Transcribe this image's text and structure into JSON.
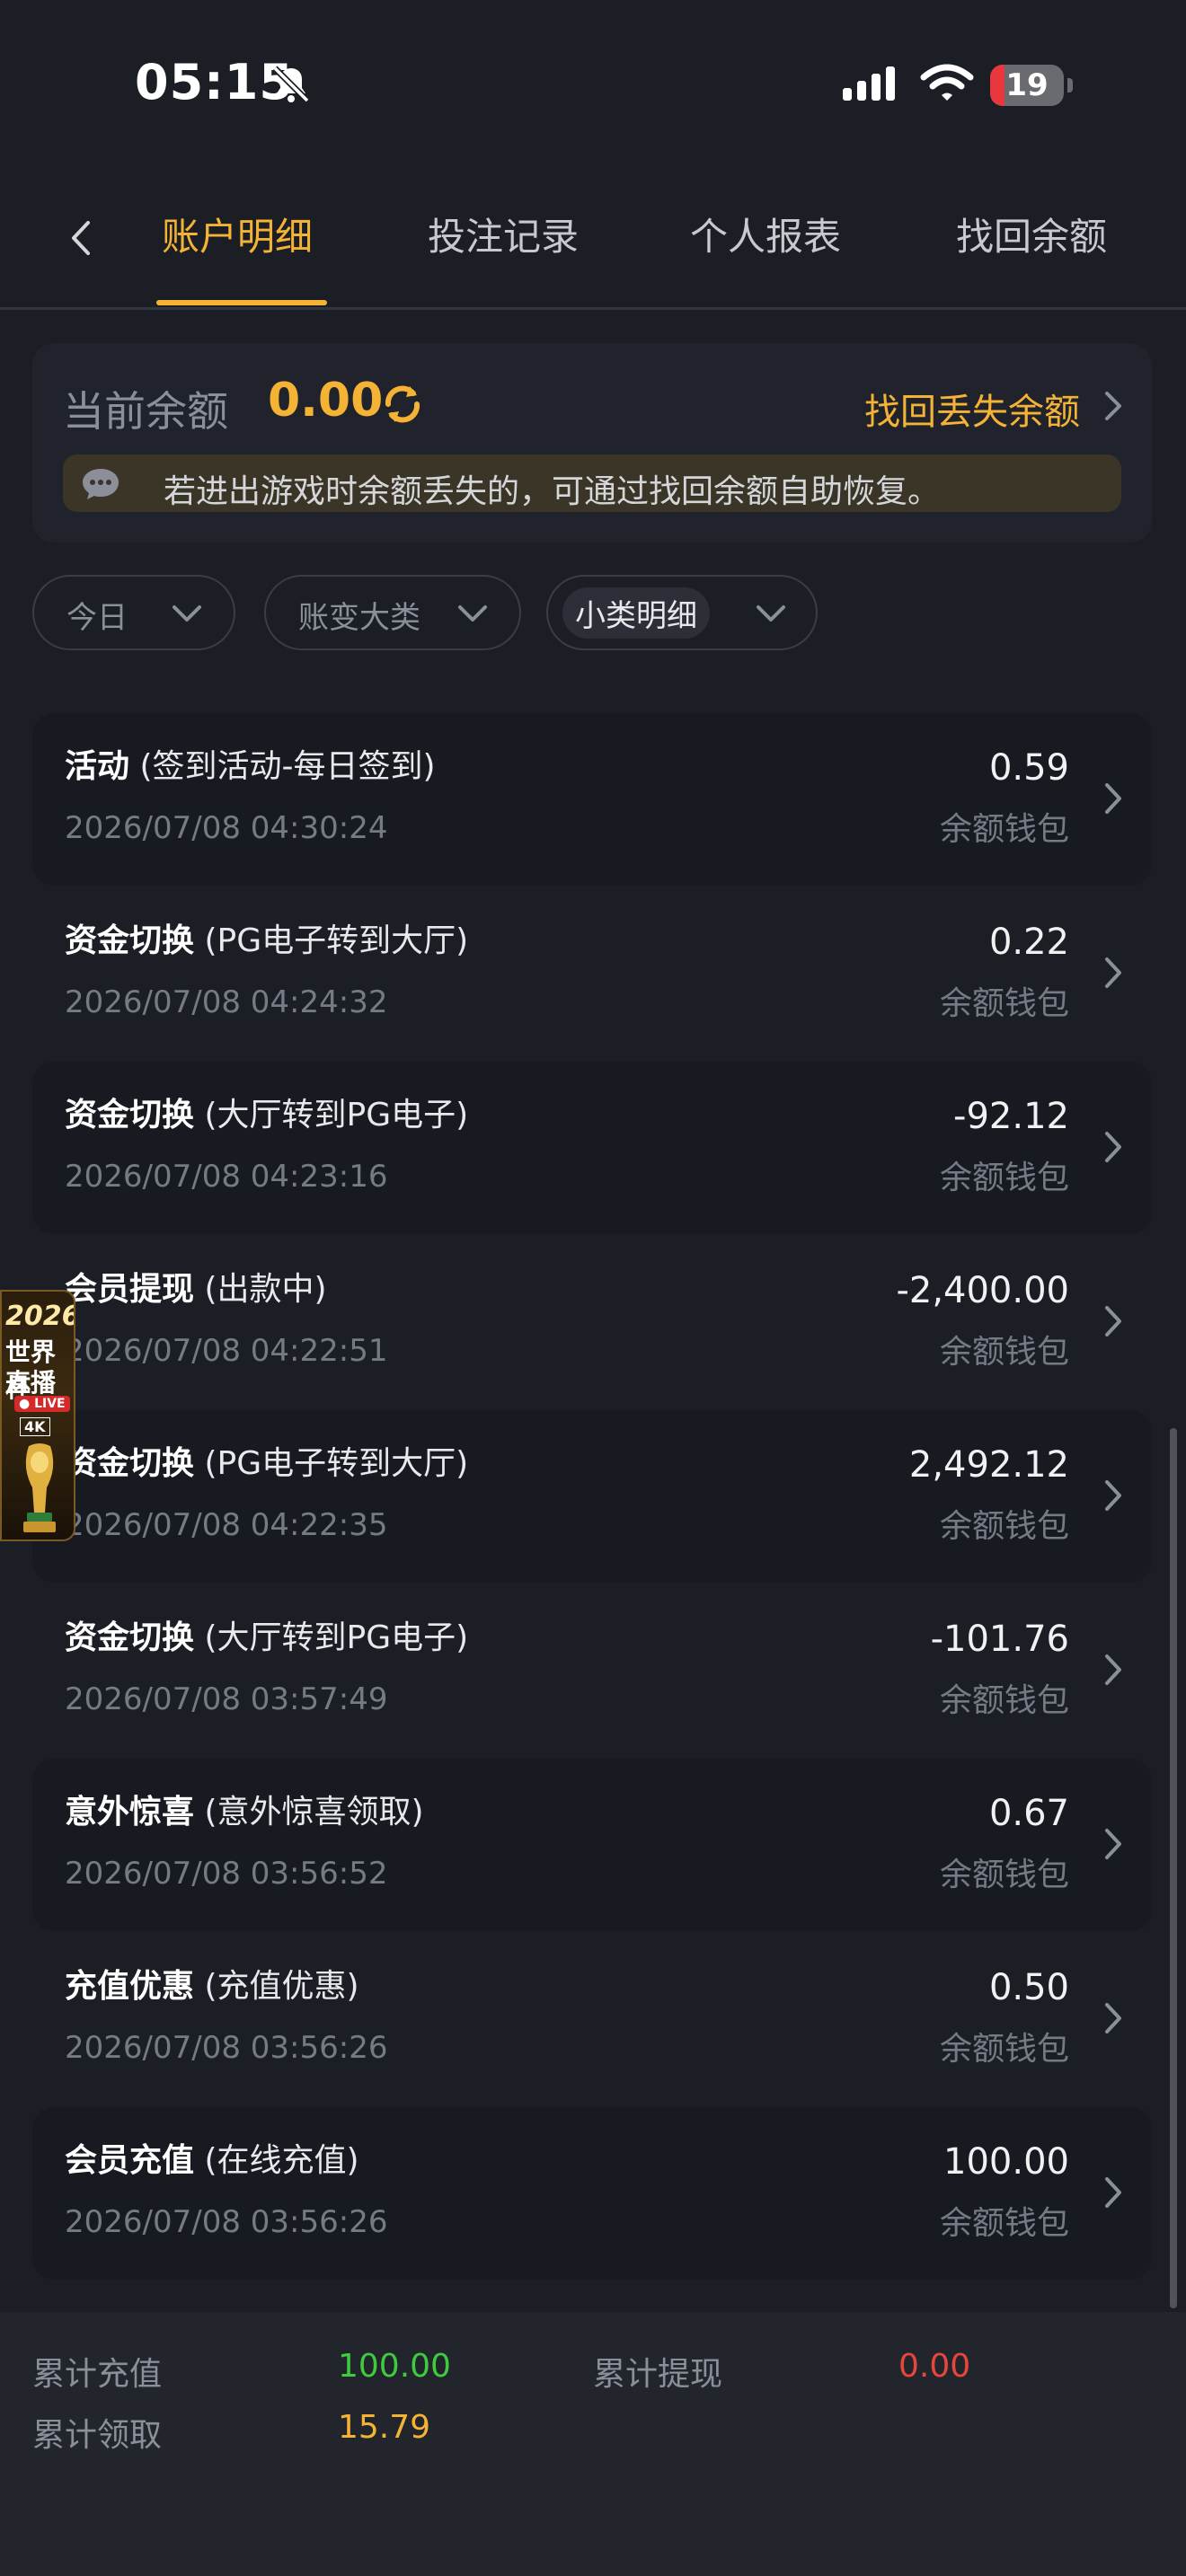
{
  "status_bar": {
    "time": "05:15",
    "battery": "19",
    "battery_level": 0.19
  },
  "tabs": [
    {
      "label": "账户明细",
      "active": true
    },
    {
      "label": "投注记录",
      "active": false
    },
    {
      "label": "个人报表",
      "active": false
    },
    {
      "label": "找回余额",
      "active": false
    }
  ],
  "balance": {
    "label": "当前余额",
    "value": "0.00",
    "recover_label": "找回丢失余额",
    "notice": "若进出游戏时余额丢失的，可通过找回余额自助恢复。"
  },
  "filters": [
    {
      "label": "今日",
      "selected": false
    },
    {
      "label": "账变大类",
      "selected": false
    },
    {
      "label": "小类明细",
      "selected": true
    }
  ],
  "transactions": [
    {
      "category": "活动",
      "detail": " (签到活动-每日签到)",
      "time": "2026/07/08 04:30:24",
      "amount": "0.59",
      "wallet": "余额钱包"
    },
    {
      "category": "资金切换",
      "detail": " (PG电子转到大厅)",
      "time": "2026/07/08 04:24:32",
      "amount": "0.22",
      "wallet": "余额钱包"
    },
    {
      "category": "资金切换",
      "detail": " (大厅转到PG电子)",
      "time": "2026/07/08 04:23:16",
      "amount": "-92.12",
      "wallet": "余额钱包"
    },
    {
      "category": "会员提现",
      "detail": " (出款中)",
      "time": "2026/07/08 04:22:51",
      "amount": "-2,400.00",
      "wallet": "余额钱包"
    },
    {
      "category": "资金切换",
      "detail": " (PG电子转到大厅)",
      "time": "2026/07/08 04:22:35",
      "amount": "2,492.12",
      "wallet": "余额钱包"
    },
    {
      "category": "资金切换",
      "detail": " (大厅转到PG电子)",
      "time": "2026/07/08 03:57:49",
      "amount": "-101.76",
      "wallet": "余额钱包"
    },
    {
      "category": "意外惊喜",
      "detail": " (意外惊喜领取)",
      "time": "2026/07/08 03:56:52",
      "amount": "0.67",
      "wallet": "余额钱包"
    },
    {
      "category": "充值优惠",
      "detail": " (充值优惠)",
      "time": "2026/07/08 03:56:26",
      "amount": "0.50",
      "wallet": "余额钱包"
    },
    {
      "category": "会员充值",
      "detail": " (在线充值)",
      "time": "2026/07/08 03:56:26",
      "amount": "100.00",
      "wallet": "余额钱包"
    }
  ],
  "promo_badge": {
    "year": "2026",
    "line1": "世界杯",
    "line2": "直播",
    "live": "● LIVE",
    "quality": "4K"
  },
  "summary": {
    "recharge_label": "累计充值",
    "recharge_value": "100.00",
    "withdraw_label": "累计提现",
    "withdraw_value": "0.00",
    "claim_label": "累计领取",
    "claim_value": "15.79"
  },
  "colors": {
    "accent": "#f5b335",
    "positive": "#3ecb3e",
    "negative": "#e8453c",
    "background": "#1c1e25"
  },
  "icons": [
    "bell-slash-icon",
    "signal-icon",
    "wifi-icon",
    "battery-icon",
    "back-chevron-icon",
    "refresh-icon",
    "chat-bubble-icon",
    "chevron-down-icon",
    "chevron-right-icon",
    "trophy-icon"
  ]
}
